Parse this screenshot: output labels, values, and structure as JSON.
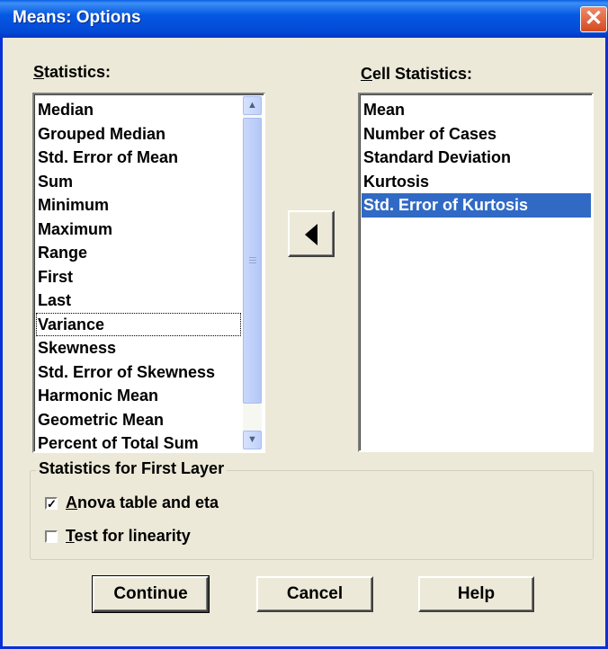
{
  "window": {
    "title": "Means: Options",
    "close_glyph": "✕"
  },
  "statistics": {
    "label_prefix": "S",
    "label_rest": "tatistics:",
    "items": [
      "Median",
      "Grouped Median",
      "Std. Error of Mean",
      "Sum",
      "Minimum",
      "Maximum",
      "Range",
      "First",
      "Last",
      "Variance",
      "Skewness",
      "Std. Error of Skewness",
      "Harmonic Mean",
      "Geometric Mean",
      "Percent of Total Sum"
    ],
    "focused_item": "Variance"
  },
  "cell_statistics": {
    "label_prefix": "C",
    "label_rest": "ell Statistics:",
    "items": [
      "Mean",
      "Number of Cases",
      "Standard Deviation",
      "Kurtosis",
      "Std. Error of Kurtosis"
    ],
    "selected_item": "Std. Error of Kurtosis"
  },
  "move_button": {
    "icon": "left-arrow-icon"
  },
  "first_layer": {
    "legend": "Statistics for First Layer",
    "anova": {
      "prefix": "A",
      "rest": "nova table and eta",
      "checked": true,
      "check_glyph": "✓"
    },
    "linearity": {
      "prefix": "T",
      "rest": "est for linearity",
      "checked": false
    }
  },
  "buttons": {
    "continue": "Continue",
    "cancel": "Cancel",
    "help": "Help"
  },
  "colors": {
    "title_bar": "#0558E2",
    "selection": "#316AC5",
    "dialog_bg": "#ECE9D8"
  }
}
